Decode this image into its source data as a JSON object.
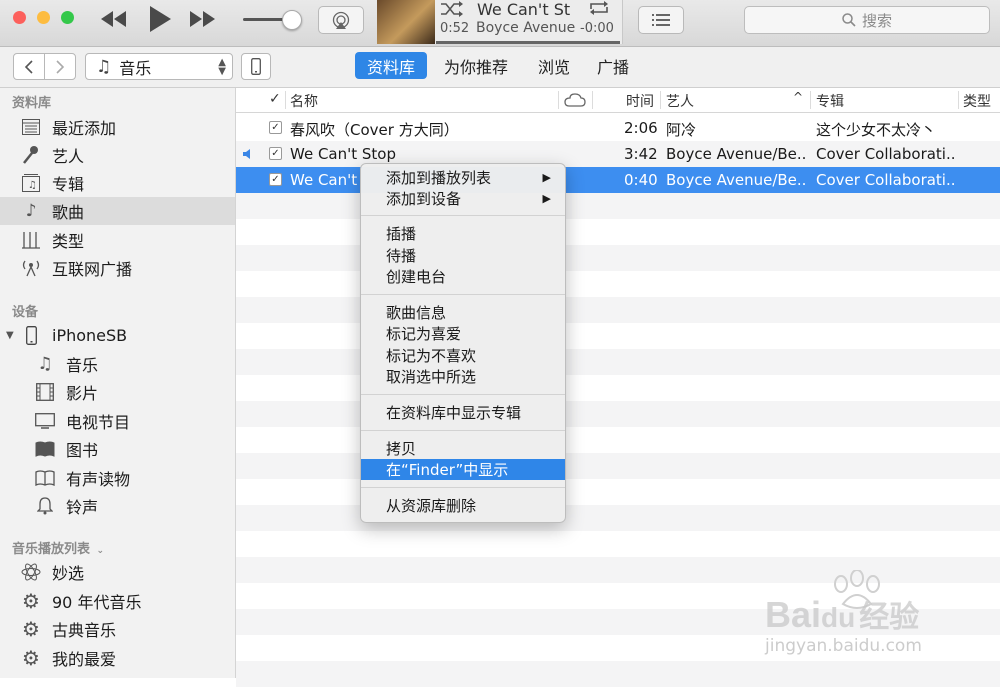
{
  "player": {
    "now_playing_title": "We Can't St",
    "now_playing_artist": "Boyce Avenue",
    "elapsed": "0:52",
    "remaining": "-0:00"
  },
  "search": {
    "placeholder": "搜索"
  },
  "nav": {
    "media_selector": "音乐",
    "tabs": [
      "资料库",
      "为你推荐",
      "浏览",
      "广播"
    ]
  },
  "sidebar": {
    "library_header": "资料库",
    "library_items": [
      {
        "label": "最近添加",
        "icon": "recently-added-icon"
      },
      {
        "label": "艺人",
        "icon": "microphone-icon"
      },
      {
        "label": "专辑",
        "icon": "album-icon"
      },
      {
        "label": "歌曲",
        "icon": "note-icon"
      },
      {
        "label": "类型",
        "icon": "genre-icon"
      },
      {
        "label": "互联网广播",
        "icon": "radio-icon"
      }
    ],
    "devices_header": "设备",
    "device_name": "iPhoneSB",
    "device_items": [
      {
        "label": "音乐",
        "icon": "note-icon"
      },
      {
        "label": "影片",
        "icon": "film-icon"
      },
      {
        "label": "电视节目",
        "icon": "tv-icon"
      },
      {
        "label": "图书",
        "icon": "book-icon"
      },
      {
        "label": "有声读物",
        "icon": "audiobook-icon"
      },
      {
        "label": "铃声",
        "icon": "bell-icon"
      }
    ],
    "playlists_header": "音乐播放列表",
    "playlist_items": [
      {
        "label": "妙选",
        "icon": "atom-icon"
      },
      {
        "label": "90 年代音乐",
        "icon": "gear-icon"
      },
      {
        "label": "古典音乐",
        "icon": "gear-icon"
      },
      {
        "label": "我的最爱",
        "icon": "gear-icon"
      }
    ]
  },
  "table": {
    "columns": {
      "check": "✓",
      "name": "名称",
      "time": "时间",
      "artist": "艺人",
      "album": "专辑",
      "genre": "类型"
    },
    "rows": [
      {
        "name": "春风吹（Cover 方大同）",
        "time": "2:06",
        "artist": "阿冷",
        "album": "这个少女不太冷丶"
      },
      {
        "name": "We Can't Stop",
        "time": "3:42",
        "artist": "Boyce Avenue/Be...",
        "album": "Cover Collaborati..."
      },
      {
        "name": "We Can't",
        "time": "0:40",
        "artist": "Boyce Avenue/Be...",
        "album": "Cover Collaborati..."
      }
    ]
  },
  "context_menu": {
    "items": [
      "添加到播放列表",
      "添加到设备",
      "插播",
      "待播",
      "创建电台",
      "歌曲信息",
      "标记为喜爱",
      "标记为不喜欢",
      "取消选中所选",
      "在资料库中显示专辑",
      "拷贝",
      "在“Finder”中显示",
      "从资源库删除"
    ],
    "highlighted": "在“Finder”中显示"
  },
  "watermark": {
    "brand_a": "Bai",
    "brand_b": "du",
    "brand_cn": "经验",
    "url": "jingyan.baidu.com"
  },
  "colors": {
    "accent": "#2e86e6",
    "selection": "#3d8ef0",
    "close": "#fc605c",
    "minimize": "#fdbc40",
    "zoom": "#34c84a"
  }
}
